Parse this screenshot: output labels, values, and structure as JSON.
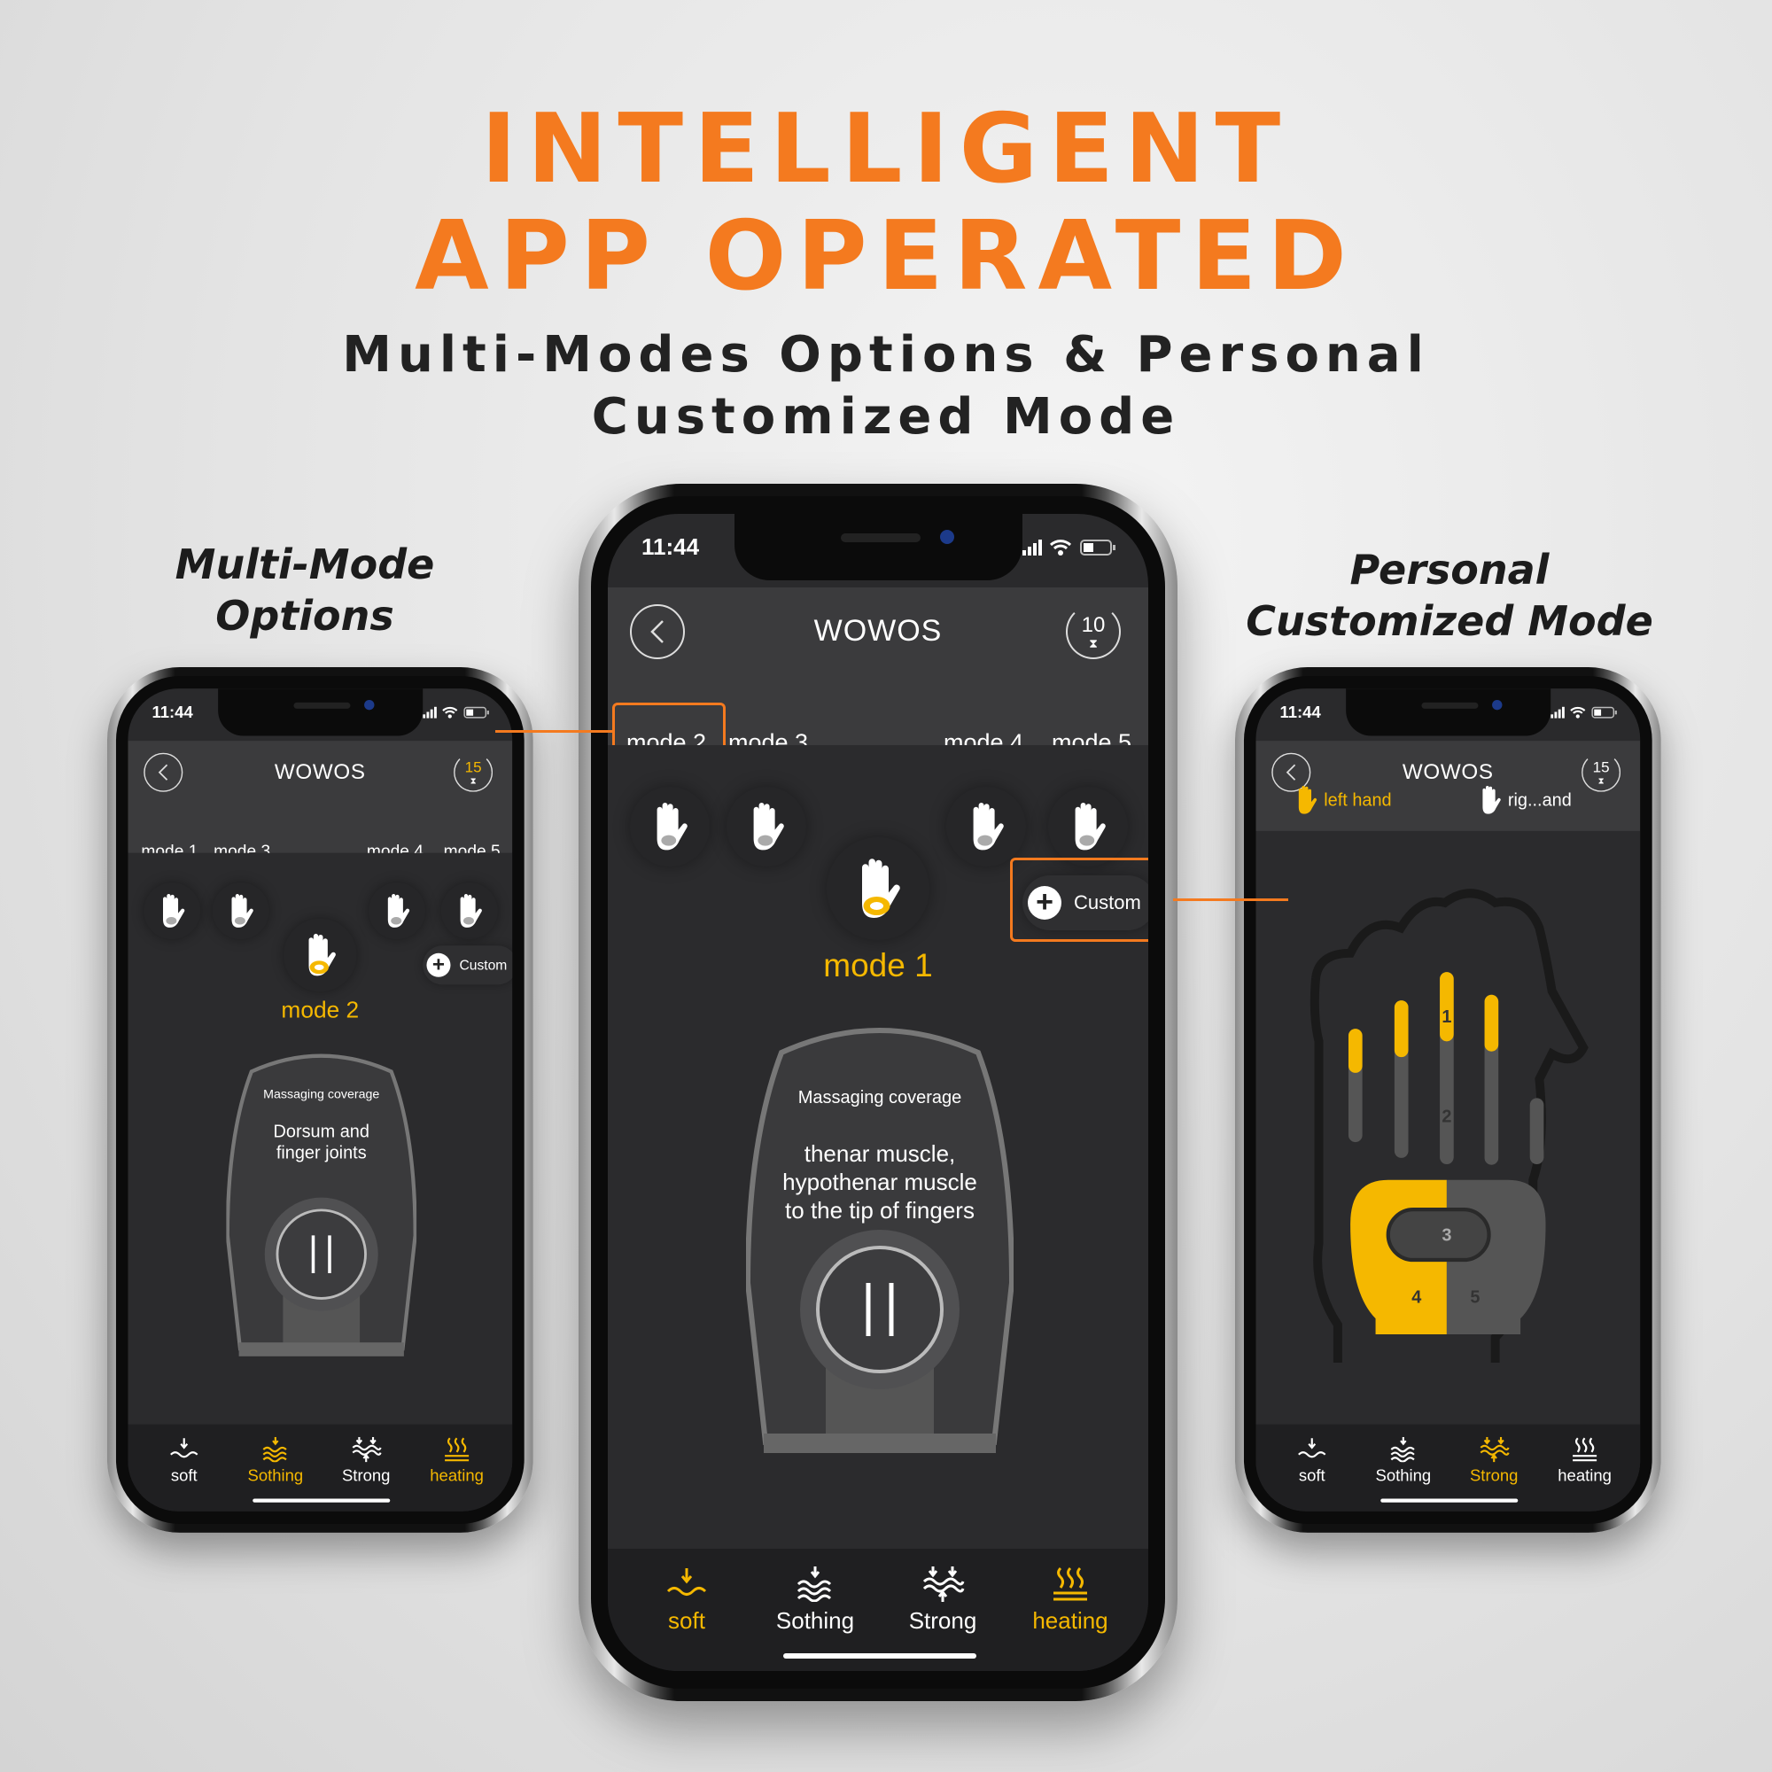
{
  "heading": {
    "line1": "INTELLIGENT",
    "line2": "APP OPERATED",
    "sub1": "Multi-Modes Options & Personal",
    "sub2": "Customized Mode"
  },
  "labels": {
    "left_line1": "Multi-Mode",
    "left_line2": "Options",
    "right_line1": "Personal",
    "right_line2": "Customized Mode"
  },
  "colors": {
    "accent": "#f47a1f",
    "app_yellow": "#f5b800",
    "screen_bg": "#2b2b2d"
  },
  "center": {
    "time": "11:44",
    "title": "WOWOS",
    "timer": "10",
    "modes": [
      "mode 2",
      "mode 3",
      "mode 4",
      "mode 5"
    ],
    "active_mode": "mode 1",
    "custom": "Custom",
    "coverage_title": "Massaging coverage",
    "coverage_lines": [
      "thenar muscle,",
      "hypothenar muscle",
      "to the tip of fingers"
    ],
    "tabs": [
      "soft",
      "Sothing",
      "Strong",
      "heating"
    ],
    "tabs_active": [
      "soft",
      "heating"
    ]
  },
  "left": {
    "time": "11:44",
    "title": "WOWOS",
    "timer": "15",
    "modes": [
      "mode 1",
      "mode 3",
      "mode 4",
      "mode 5"
    ],
    "active_mode": "mode 2",
    "custom": "Custom",
    "coverage_title": "Massaging coverage",
    "coverage_lines": [
      "Dorsum and",
      "finger joints"
    ],
    "tabs": [
      "soft",
      "Sothing",
      "Strong",
      "heating"
    ],
    "tabs_active": [
      "Sothing",
      "heating"
    ]
  },
  "right": {
    "time": "11:44",
    "title": "WOWOS",
    "timer": "15",
    "left_hand": "left hand",
    "right_hand": "rig...and",
    "zones": [
      "1",
      "2",
      "3",
      "4",
      "5"
    ],
    "tabs": [
      "soft",
      "Sothing",
      "Strong",
      "heating"
    ],
    "tabs_active": [
      "Strong"
    ]
  }
}
